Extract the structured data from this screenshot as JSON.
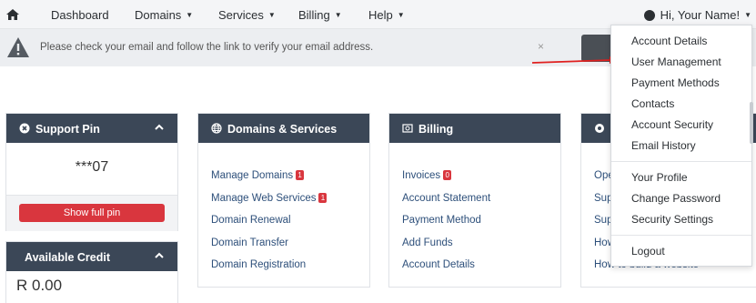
{
  "nav": {
    "home_icon": "home-icon",
    "items": [
      "Dashboard",
      "Domains",
      "Services",
      "Billing",
      "Help"
    ],
    "user_label": "Hi, Your Name!"
  },
  "alert": {
    "message": "Please check your email and follow the link to verify your email address.",
    "close": "×"
  },
  "support_pin": {
    "title": "Support Pin",
    "value": "***07",
    "button": "Show full pin"
  },
  "credit": {
    "title": "Available Credit",
    "value": "R 0.00"
  },
  "domains_services": {
    "title": "Domains & Services",
    "links": [
      {
        "label": "Manage Domains",
        "badge": "1"
      },
      {
        "label": "Manage Web Services",
        "badge": "1"
      },
      {
        "label": "Domain Renewal",
        "badge": ""
      },
      {
        "label": "Domain Transfer",
        "badge": ""
      },
      {
        "label": "Domain Registration",
        "badge": ""
      }
    ]
  },
  "billing": {
    "title": "Billing",
    "links": [
      {
        "label": "Invoices",
        "badge": "0"
      },
      {
        "label": "Account Statement",
        "badge": ""
      },
      {
        "label": "Payment Method",
        "badge": ""
      },
      {
        "label": "Add Funds",
        "badge": ""
      },
      {
        "label": "Account Details",
        "badge": ""
      }
    ]
  },
  "support_panel": {
    "links": [
      "Ope",
      "Sup",
      "Sup",
      "How",
      "How to build a website"
    ]
  },
  "dropdown": {
    "group1": [
      "Account Details",
      "User Management",
      "Payment Methods",
      "Contacts",
      "Account Security",
      "Email History"
    ],
    "group2": [
      "Your Profile",
      "Change Password",
      "Security Settings"
    ],
    "group3": [
      "Logout"
    ]
  },
  "colors": {
    "panel_header": "#3b4757",
    "danger": "#d9363e",
    "link": "#2d4f7a"
  }
}
